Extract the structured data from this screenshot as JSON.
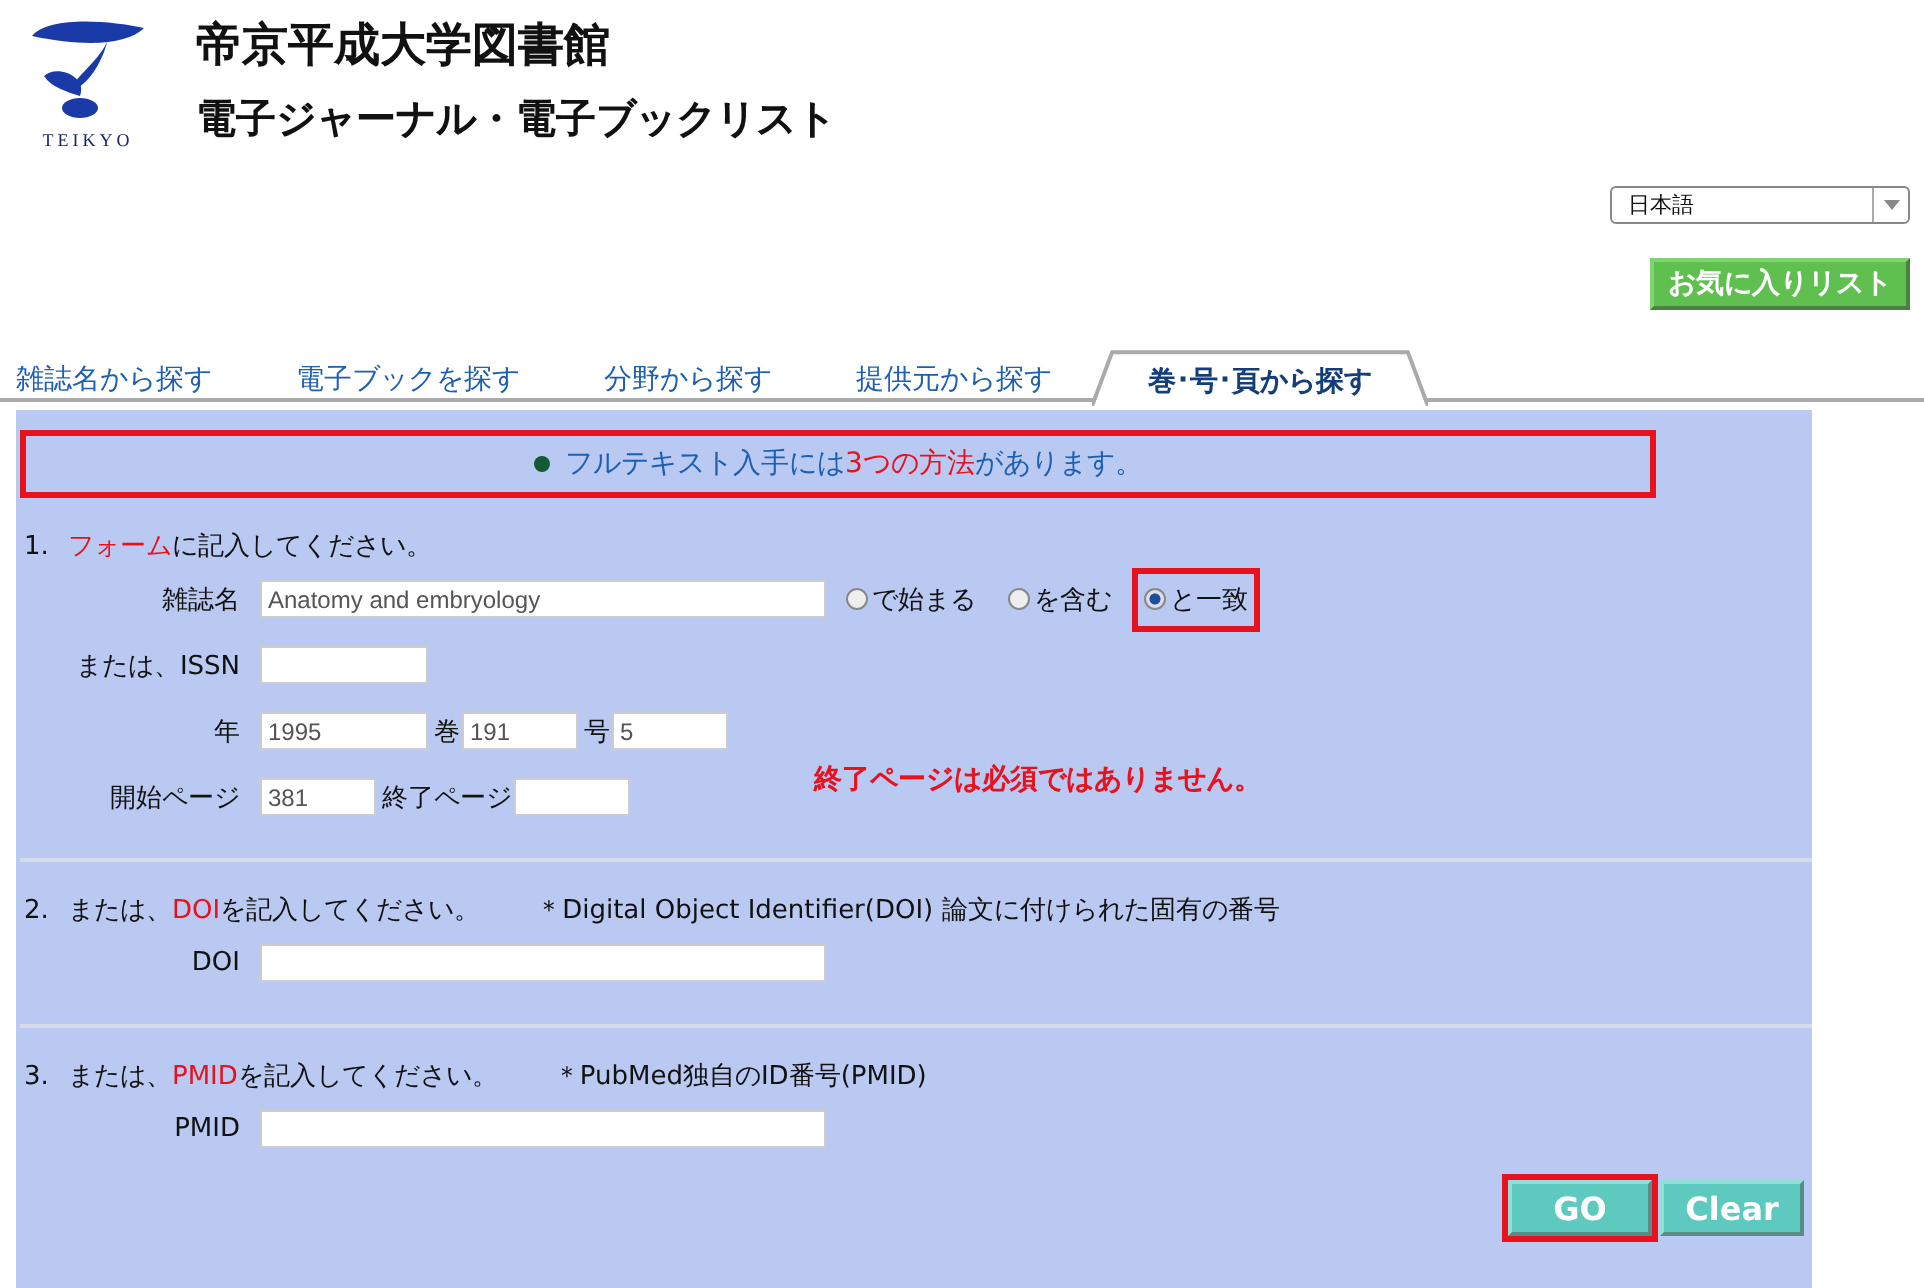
{
  "header": {
    "logo_text": "TEIKYO",
    "title": "帝京平成大学図書館",
    "subtitle": "電子ジャーナル・電子ブックリスト"
  },
  "language_select": {
    "value": "日本語"
  },
  "favorites_button": {
    "label": "お気に入りリスト"
  },
  "tabs": [
    {
      "label": "雑誌名から探す",
      "selected": false
    },
    {
      "label": "電子ブックを探す",
      "selected": false
    },
    {
      "label": "分野から探す",
      "selected": false
    },
    {
      "label": "提供元から探す",
      "selected": false
    },
    {
      "label": "巻･号･頁から探す",
      "selected": true
    }
  ],
  "notice": {
    "highlighted": true,
    "parts": [
      {
        "text": "フルテキスト入手には",
        "emphasis": false
      },
      {
        "text": "3つの方法",
        "emphasis": true
      },
      {
        "text": "があります。",
        "emphasis": false
      }
    ]
  },
  "section_1": {
    "number": "1.",
    "parts": [
      {
        "text": "フォーム",
        "emphasis": true
      },
      {
        "text": "に記入してください。",
        "emphasis": false
      }
    ],
    "journal": {
      "label": "雑誌名",
      "value": "Anatomy and embryology",
      "options": [
        {
          "label": "で始まる",
          "selected": false,
          "highlighted": false
        },
        {
          "label": "を含む",
          "selected": false,
          "highlighted": false
        },
        {
          "label": "と一致",
          "selected": true,
          "highlighted": true
        }
      ]
    },
    "issn": {
      "label": "または、ISSN"
    },
    "year": {
      "label": "年",
      "value": "1995"
    },
    "volume": {
      "label": "巻",
      "value": "191"
    },
    "issue": {
      "label": "号",
      "value": "5"
    },
    "start_page": {
      "label": "開始ページ",
      "value": "381"
    },
    "end_page": {
      "label": "終了ページ"
    },
    "note": "終了ページは必須ではありません。"
  },
  "section_2": {
    "number": "2.",
    "parts": [
      {
        "text": "または、",
        "emphasis": false
      },
      {
        "text": "DOI",
        "emphasis": true
      },
      {
        "text": "を記入してください。",
        "emphasis": false
      }
    ],
    "hint": "＊Digital Object Identifier(DOI)  論文に付けられた固有の番号",
    "field_label": "DOI"
  },
  "section_3": {
    "number": "3.",
    "parts": [
      {
        "text": "または、",
        "emphasis": false
      },
      {
        "text": "PMID",
        "emphasis": true
      },
      {
        "text": "を記入してください。",
        "emphasis": false
      }
    ],
    "hint": "＊PubMed独自のID番号(PMID)",
    "field_label": "PMID"
  },
  "buttons": [
    {
      "label": "GO",
      "highlighted": true
    },
    {
      "label": "Clear",
      "highlighted": false
    }
  ]
}
